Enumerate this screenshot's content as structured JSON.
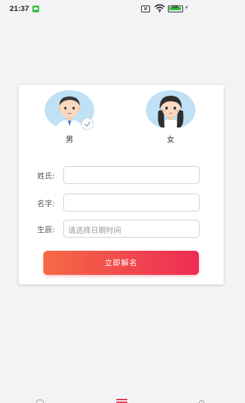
{
  "status_bar": {
    "time": "21:37",
    "battery": "100"
  },
  "gender": {
    "male_label": "男",
    "female_label": "女",
    "selected": "male"
  },
  "form": {
    "surname_label": "姓氏:",
    "surname_value": "",
    "given_name_label": "名字:",
    "given_name_value": "",
    "birth_label": "生辰:",
    "birth_placeholder": "请选择日期时间"
  },
  "actions": {
    "submit_label": "立即解名"
  },
  "colors": {
    "accent_start": "#f46a46",
    "accent_end": "#ef2c55",
    "avatar_bg": "#bfe0f5"
  }
}
